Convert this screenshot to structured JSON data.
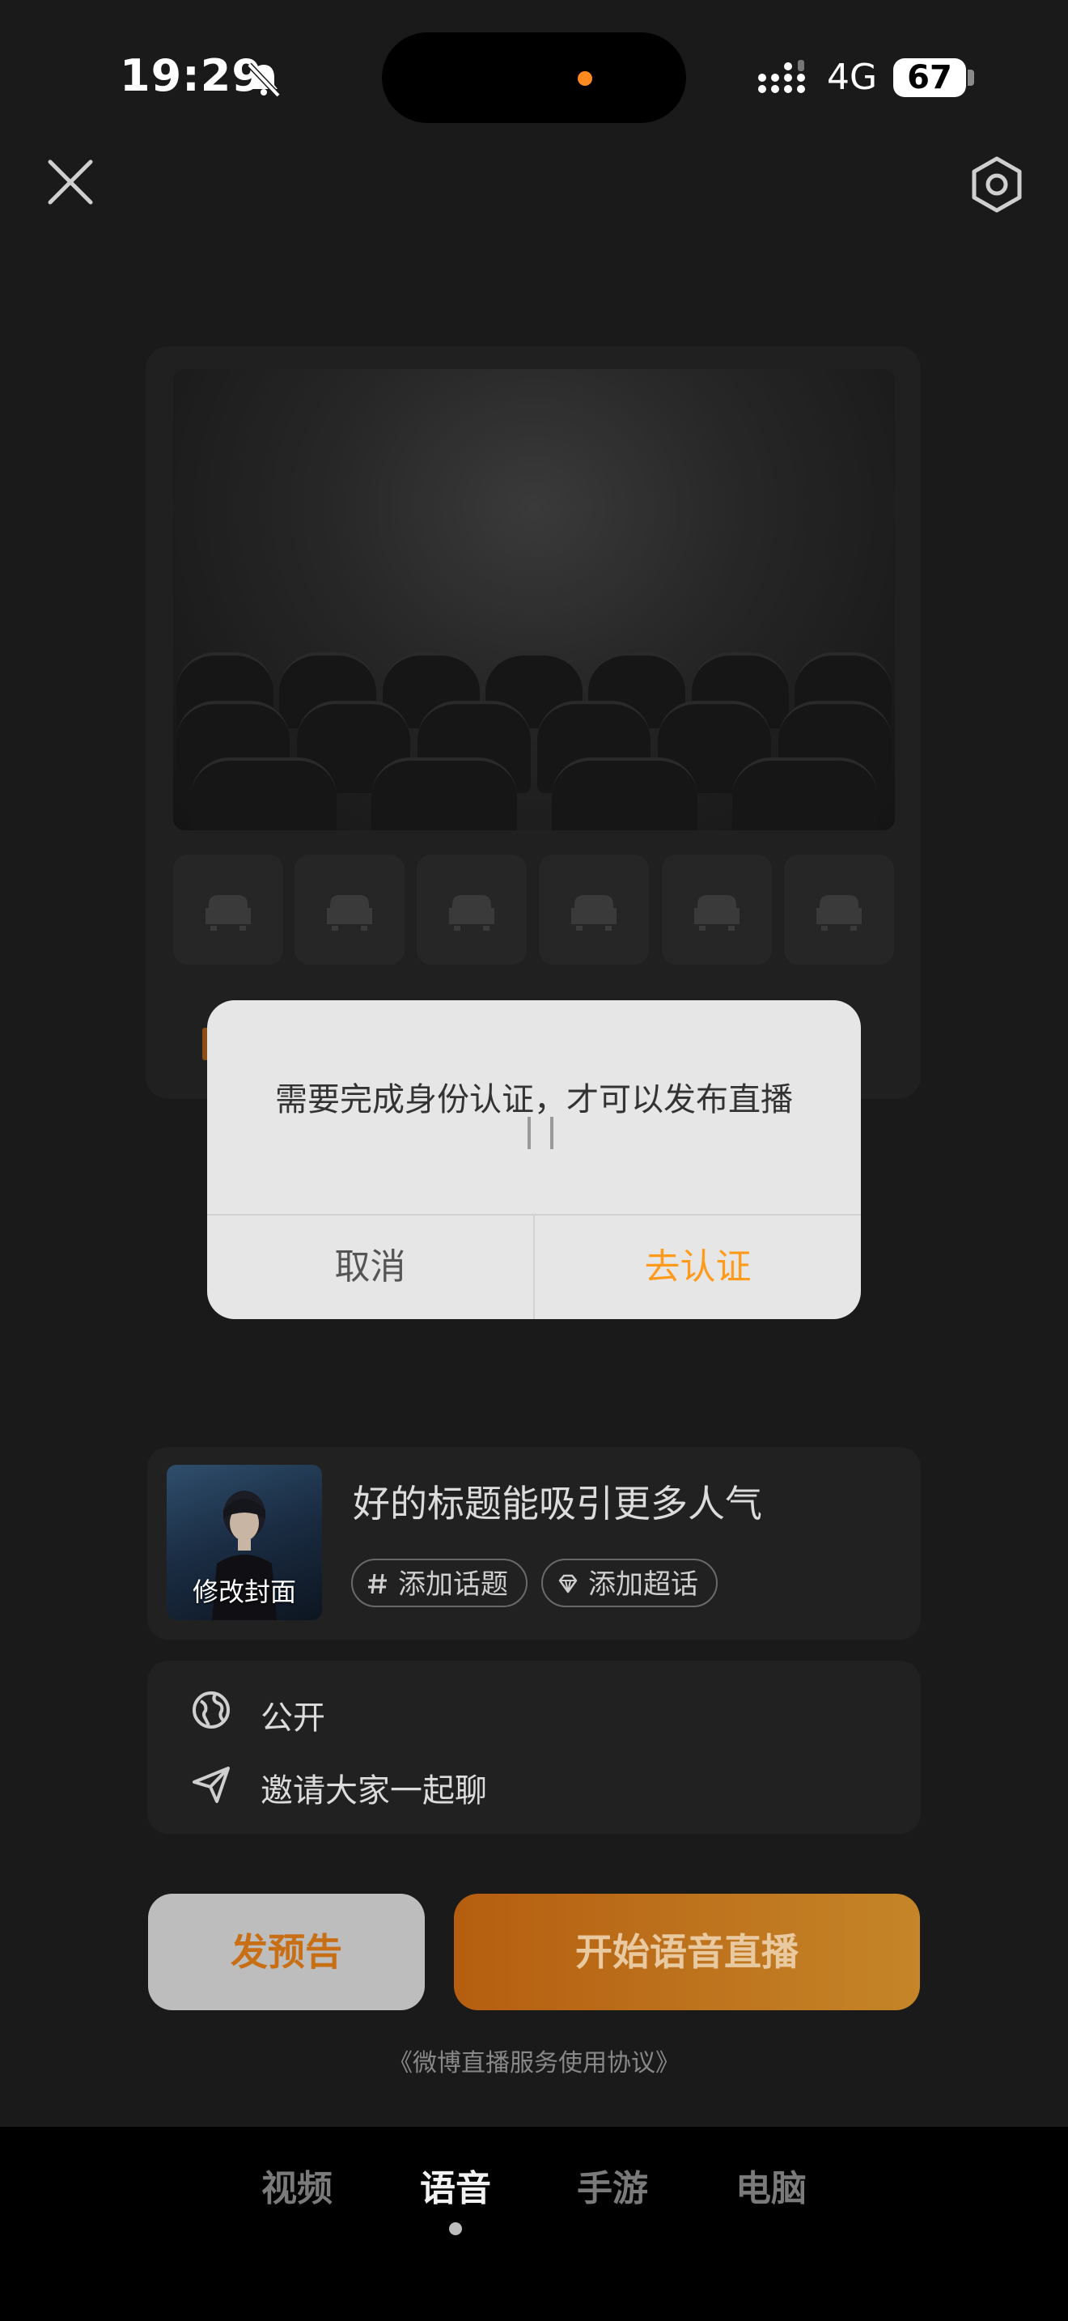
{
  "status_bar": {
    "time": "19:29",
    "network": "4G",
    "battery": "67",
    "icons": [
      "bell-muted-icon",
      "signal-icon",
      "battery-icon"
    ]
  },
  "top_bar": {
    "icons": [
      "close-icon",
      "settings-icon"
    ]
  },
  "dialog": {
    "message": "需要完成身份认证，才可以发布直播",
    "cancel_label": "取消",
    "confirm_label": "去认证"
  },
  "live_info": {
    "cover_label": "修改封面",
    "title_placeholder": "好的标题能吸引更多人气",
    "chips": [
      {
        "label": "添加话题",
        "icon": "hash-icon"
      },
      {
        "label": "添加超话",
        "icon": "diamond-icon"
      }
    ]
  },
  "settings": {
    "visibility_label": "公开",
    "invite_label": "邀请大家一起聊"
  },
  "actions": {
    "preview_label": "发预告",
    "start_label": "开始语音直播",
    "agreement": "《微博直播服务使用协议》"
  },
  "tabs": [
    {
      "label": "视频",
      "active": false
    },
    {
      "label": "语音",
      "active": true
    },
    {
      "label": "手游",
      "active": false
    },
    {
      "label": "电脑",
      "active": false
    }
  ],
  "colors": {
    "accent": "#ff9a1a",
    "start_button": "#c07018",
    "background": "#1a1a1a",
    "dialog_bg": "#e6e6e6"
  }
}
